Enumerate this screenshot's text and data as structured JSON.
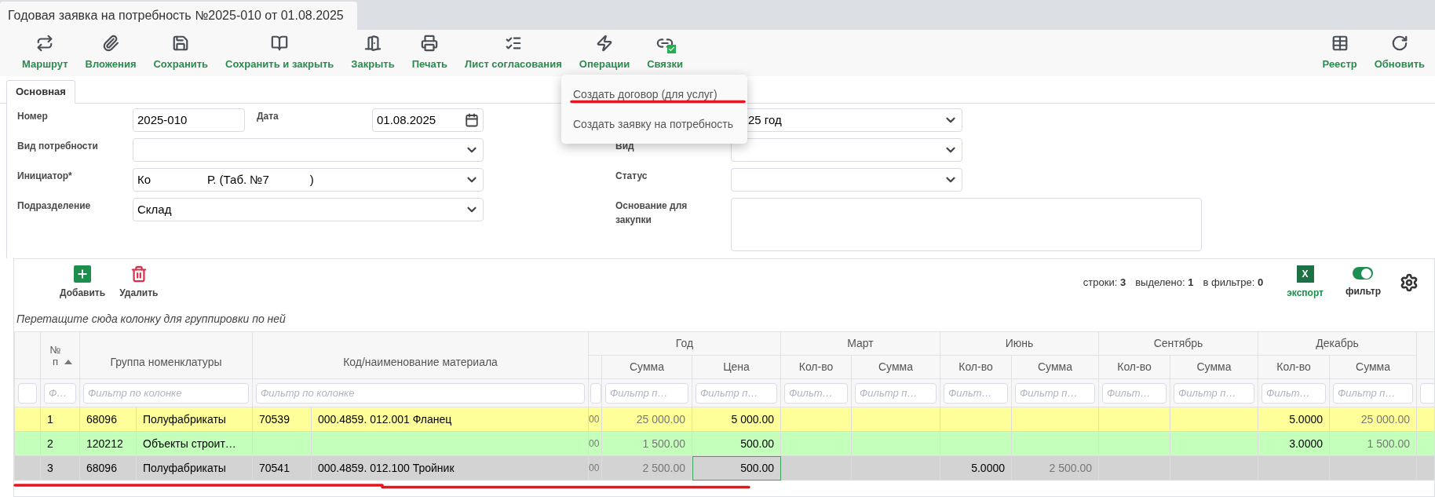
{
  "tab": {
    "title": "Годовая заявка на потребность №2025-010 от 01.08.2025"
  },
  "toolbar": {
    "left": [
      "Маршрут",
      "Вложения",
      "Сохранить",
      "Сохранить и закрыть",
      "Закрыть",
      "Печать",
      "Лист согласования",
      "Операции",
      "Связки"
    ],
    "right": [
      "Реестр",
      "Обновить"
    ]
  },
  "operations_menu": {
    "items": [
      "Создать договор (для услуг)",
      "Создать заявку на потребность"
    ]
  },
  "form_tabs": [
    {
      "label": "Основная",
      "selected": true
    }
  ],
  "form": {
    "number": {
      "label": "Номер",
      "value": "2025-010"
    },
    "date": {
      "label": "Дата",
      "value": "01.08.2025"
    },
    "need_type": {
      "label": "Вид потребности"
    },
    "initiator": {
      "label": "Инициатор*",
      "value_parts": [
        "Ко",
        "Р. (Таб. №7",
        ")"
      ]
    },
    "department": {
      "label": "Подразделение",
      "value": "Склад"
    },
    "period": {
      "value": "25 год"
    },
    "kind": {
      "label": "Вид"
    },
    "status": {
      "label": "Статус"
    },
    "basis": {
      "label": "Основание для закупки"
    }
  },
  "grid": {
    "buttons": [
      "Добавить",
      "Удалить"
    ],
    "stats": [
      {
        "label": "строки:",
        "value": "3"
      },
      {
        "label": "выделено:",
        "value": "1"
      },
      {
        "label": "в фильтре:",
        "value": "0"
      }
    ],
    "export": {
      "label": "экспорт",
      "icon_text": "X"
    },
    "filter_toggle": {
      "label": "фильтр",
      "on": true
    },
    "group_hint": "Перетащите сюда колонку для группировки по ней",
    "columns": {
      "num": "№ п",
      "group": "Группа номенклатуры",
      "material": "Код/наименование материала",
      "year": "Год",
      "year_sum": "Сумма",
      "year_price": "Цена",
      "months": [
        {
          "name": "Март",
          "qty": "Кол-во",
          "sum": "Сумма"
        },
        {
          "name": "Июнь",
          "qty": "Кол-во",
          "sum": "Сумма"
        },
        {
          "name": "Сентябрь",
          "qty": "Кол-во",
          "sum": "Сумма"
        },
        {
          "name": "Декабрь",
          "qty": "Кол-во",
          "sum": "Сумма"
        }
      ]
    },
    "filters": {
      "num": {
        "placeholder": "Ф…"
      },
      "group": {
        "placeholder": "Фильтр по колонке"
      },
      "material": {
        "placeholder": "Фильтр по колонке"
      },
      "year_sum": {
        "placeholder": "Фильтр п…"
      },
      "year_price": {
        "placeholder": "Фильтр п…"
      },
      "months": [
        {
          "qty": {
            "placeholder": "Фильт…"
          },
          "sum": {
            "placeholder": "Фильтр п…"
          }
        },
        {
          "qty": {
            "placeholder": "Фильт…"
          },
          "sum": {
            "placeholder": "Фильтр п…"
          }
        },
        {
          "qty": {
            "placeholder": "Фильт…"
          },
          "sum": {
            "placeholder": "Фильтр п…"
          }
        },
        {
          "qty": {
            "placeholder": "Фильт…"
          },
          "sum": {
            "placeholder": "Фильтр п…"
          }
        }
      ]
    },
    "rows": [
      {
        "num": "1",
        "group_code": "68096",
        "group_name": "Полуфабрикаты",
        "material_code": "70539",
        "material_name": "000.4859. 012.001 Фланец",
        "column_cut": "00",
        "year_sum": "25 000.00",
        "year_price": "5 000.00",
        "dec": {
          "qty": "5.0000",
          "sum": "25 000.00"
        },
        "selected": false,
        "color": "#ffff99",
        "price_focused": false
      },
      {
        "num": "2",
        "group_code": "120212",
        "group_name": "Объекты строит…",
        "column_cut": "00",
        "year_sum": "1 500.00",
        "year_price": "500.00",
        "dec": {
          "qty": "3.0000",
          "sum": "1 500.00"
        },
        "selected": false,
        "color": "#c4ffbc",
        "price_focused": false
      },
      {
        "num": "3",
        "group_code": "68096",
        "group_name": "Полуфабрикаты",
        "material_code": "70541",
        "material_name": "000.4859. 012.100 Тройник",
        "column_cut": "00",
        "year_sum": "2 500.00",
        "year_price": "500.00",
        "jun": {
          "qty": "5.0000",
          "sum": "2 500.00"
        },
        "selected": true,
        "price_focused": true
      }
    ]
  }
}
